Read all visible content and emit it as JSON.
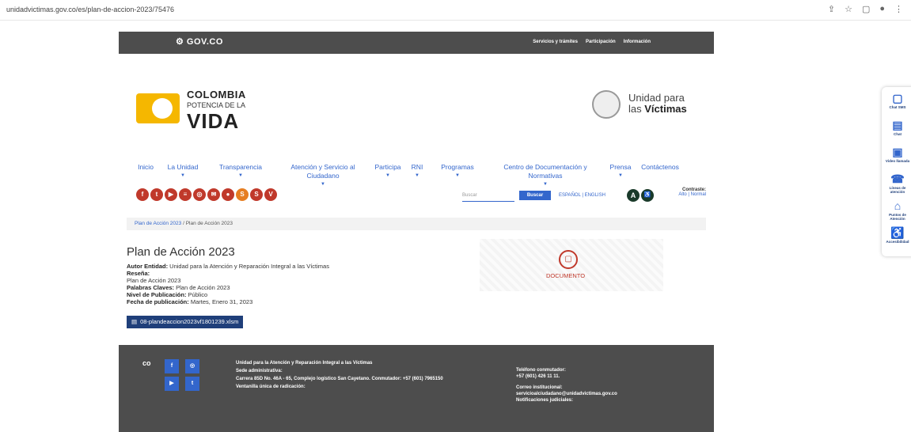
{
  "browser": {
    "url": "unidadvictimas.gov.co/es/plan-de-accion-2023/75476"
  },
  "govbar": {
    "logo": "GOV.CO",
    "links": [
      "Servicios y trámites",
      "Participación",
      "Información"
    ]
  },
  "header": {
    "colombia_line1": "COLOMBIA",
    "colombia_line2": "POTENCIA DE LA",
    "colombia_line3": "VIDA",
    "uv_line1": "Unidad para",
    "uv_line2_a": "las ",
    "uv_line2_b": "Víctimas"
  },
  "nav": [
    {
      "label": "Inicio",
      "caret": false,
      "width": 36
    },
    {
      "label": "La Unidad",
      "caret": true,
      "width": 58
    },
    {
      "label": "Transparencia",
      "caret": true,
      "width": 88
    },
    {
      "label": "Atención y Servicio al Ciudadano",
      "caret": true,
      "width": 120
    },
    {
      "label": "Participa",
      "caret": true,
      "width": 44
    },
    {
      "label": "RNI",
      "caret": true,
      "width": 30
    },
    {
      "label": "Programas",
      "caret": true,
      "width": 72
    },
    {
      "label": "Centro de Documentación y Normativas",
      "caret": true,
      "width": 150
    },
    {
      "label": "Prensa",
      "caret": true,
      "width": 40
    },
    {
      "label": "Contáctenos",
      "caret": false,
      "width": 60
    }
  ],
  "social": [
    {
      "name": "facebook-icon",
      "glyph": "f",
      "color": "#c0392b"
    },
    {
      "name": "twitter-icon",
      "glyph": "t",
      "color": "#c0392b"
    },
    {
      "name": "youtube-icon",
      "glyph": "▶",
      "color": "#c0392b"
    },
    {
      "name": "spotify-icon",
      "glyph": "≡",
      "color": "#c0392b"
    },
    {
      "name": "instagram-icon",
      "glyph": "◎",
      "color": "#c0392b"
    },
    {
      "name": "mail-icon",
      "glyph": "✉",
      "color": "#c0392b"
    },
    {
      "name": "app-icon",
      "glyph": "●",
      "color": "#c0392b"
    },
    {
      "name": "s-icon",
      "glyph": "S",
      "color": "#e67e22"
    },
    {
      "name": "s2-icon",
      "glyph": "S",
      "color": "#c0392b"
    },
    {
      "name": "v-icon",
      "glyph": "V",
      "color": "#c0392b"
    }
  ],
  "search": {
    "placeholder": "Buscar",
    "button": "Buscar"
  },
  "lang": {
    "es": "ESPAÑOL",
    "en": "ENGLISH"
  },
  "contrast": {
    "label": "Contraste:",
    "high": "Alto",
    "normal": "Normal"
  },
  "breadcrumb": {
    "link": "Plan de Acción 2023",
    "current": "Plan de Acción 2023"
  },
  "document": {
    "title": "Plan de Acción 2023",
    "autor_label": "Autor Entidad:",
    "autor_value": "Unidad para la Atención y Reparación Integral a las Víctimas",
    "resena_label": "Reseña:",
    "resena_value": "Plan de Acción 2023",
    "palabras_label": "Palabras Claves:",
    "palabras_value": "Plan de Acción 2023",
    "nivel_label": "Nivel de Publicación:",
    "nivel_value": "Público",
    "fecha_label": "Fecha de publicación:",
    "fecha_value": "Martes, Enero 31, 2023",
    "image_label": "DOCUMENTO",
    "file": "08-plandeaccion2023vf1801239.xlsm"
  },
  "footer": {
    "org": "Unidad para la Atención y Reparación Integral a las Víctimas",
    "sede_label": "Sede administrativa:",
    "address": "Carrera 85D No. 46A - 65, Complejo logístico San Cayetano. Conmutador: +57 (601) 7965150",
    "ventanilla": "Ventanilla única de radicación:",
    "tel_label": "Teléfono conmutador:",
    "tel_value": "+57 (601) 426 11 11.",
    "correo_label": "Correo institucional:",
    "correo_value": "servicioalciudadano@unidadvictimas.gov.co",
    "notif_label": "Notificaciones judiciales:"
  },
  "widget": [
    {
      "name": "chat-sms-icon",
      "glyph": "▢",
      "label": "Chat SMS"
    },
    {
      "name": "chat-icon",
      "glyph": "▤",
      "label": "Chat"
    },
    {
      "name": "video-call-icon",
      "glyph": "▣",
      "label": "Video llamada"
    },
    {
      "name": "phone-lines-icon",
      "glyph": "☎",
      "label": "Líneas de atención"
    },
    {
      "name": "map-points-icon",
      "glyph": "⌂",
      "label": "Puntos de Atención"
    },
    {
      "name": "accessibility-icon",
      "glyph": "♿",
      "label": "Accesibilidad"
    }
  ]
}
